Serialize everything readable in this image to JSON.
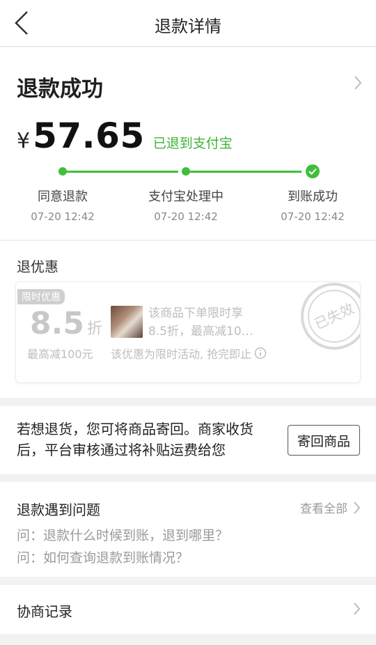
{
  "nav": {
    "title": "退款详情"
  },
  "status": {
    "title": "退款成功",
    "currency": "¥",
    "amount": "57.65",
    "note": "已退到支付宝",
    "steps": [
      {
        "label": "同意退款",
        "time": "07-20 12:42"
      },
      {
        "label": "支付宝处理中",
        "time": "07-20 12:42"
      },
      {
        "label": "到账成功",
        "time": "07-20 12:42"
      }
    ],
    "accent_color": "#3fbe3c"
  },
  "coupon": {
    "heading": "退优惠",
    "tag": "限时优惠",
    "discount_value": "8.5",
    "discount_unit": "折",
    "max_reduction": "最高减100元",
    "desc_line1": "该商品下单限时享",
    "desc_line2": "8.5折，最高减10…",
    "note": "该优惠为限时活动, 抢完即止",
    "stamp_text": "已失效"
  },
  "return": {
    "text_line1": "若想退货，您可将商品寄回。商家收货",
    "text_line2": "后，平台审核通过将补贴运费给您",
    "button_label": "寄回商品"
  },
  "faq": {
    "title": "退款遇到问题",
    "view_all": "查看全部",
    "questions": [
      "问：退款什么时候到账，退到哪里？",
      "问：如何查询退款到账情况？"
    ]
  },
  "log": {
    "title": "协商记录"
  }
}
